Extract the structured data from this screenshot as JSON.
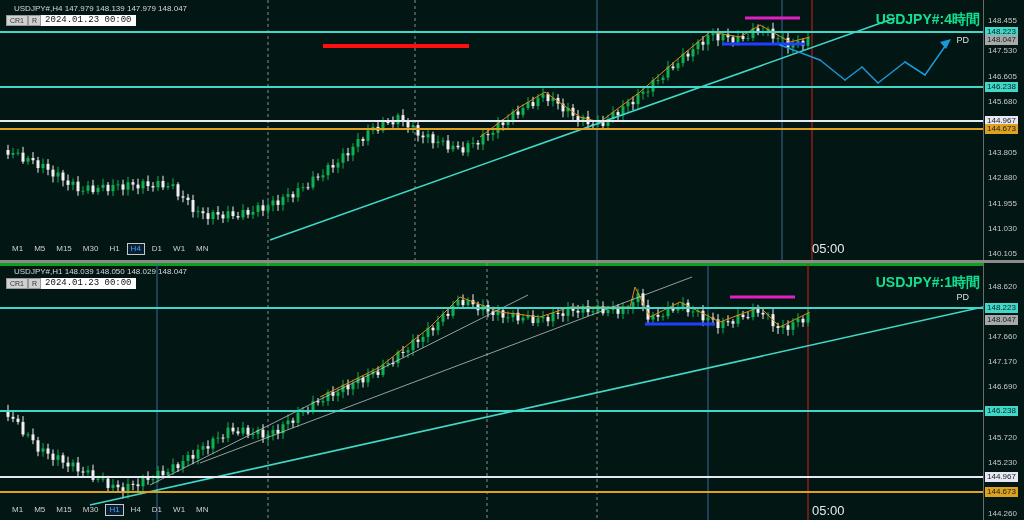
{
  "panels": [
    {
      "header": "USDJPY#,H4  147.979 148.139 147.979 148.047",
      "buttons": [
        "CR1",
        "R"
      ],
      "date": "2024.01.23 00:00",
      "title": "USDJPY#:4時間",
      "note": "PD",
      "time_label": "05:00",
      "timeframes": [
        {
          "label": "M1",
          "selected": false
        },
        {
          "label": "M5",
          "selected": false
        },
        {
          "label": "M15",
          "selected": false
        },
        {
          "label": "M30",
          "selected": false
        },
        {
          "label": "H1",
          "selected": false
        },
        {
          "label": "H4",
          "selected": true
        },
        {
          "label": "D1",
          "selected": false
        },
        {
          "label": "W1",
          "selected": false
        },
        {
          "label": "MN",
          "selected": false
        }
      ],
      "axis_ticks": [
        "148.455",
        "147.530",
        "146.605",
        "145.680",
        "143.805",
        "142.880",
        "141.955",
        "141.030",
        "140.105"
      ],
      "price_tags": [
        {
          "text": "148.223",
          "color": "#40d8c8",
          "kind": "level"
        },
        {
          "text": "148.047",
          "color": "#a8a8a8",
          "kind": "current"
        },
        {
          "text": "146.238",
          "color": "#40d8c8",
          "kind": "level"
        },
        {
          "text": "144.967",
          "color": "#e8e8f4",
          "kind": "level"
        },
        {
          "text": "144.673",
          "color": "#e0a020",
          "kind": "level"
        }
      ]
    },
    {
      "header": "USDJPY#,H1  148.039 148.050 148.029 148.047",
      "buttons": [
        "CR1",
        "R"
      ],
      "date": "2024.01.23 00:00",
      "title": "USDJPY#:1時間",
      "note": "PD",
      "time_label": "05:00",
      "timeframes": [
        {
          "label": "M1",
          "selected": false
        },
        {
          "label": "M5",
          "selected": false
        },
        {
          "label": "M15",
          "selected": false
        },
        {
          "label": "M30",
          "selected": false
        },
        {
          "label": "H1",
          "selected": true
        },
        {
          "label": "H4",
          "selected": false
        },
        {
          "label": "D1",
          "selected": false
        },
        {
          "label": "W1",
          "selected": false
        },
        {
          "label": "MN",
          "selected": false
        }
      ],
      "axis_ticks": [
        "148.620",
        "147.660",
        "147.170",
        "146.690",
        "145.720",
        "145.230",
        "144.260"
      ],
      "price_tags": [
        {
          "text": "148.223",
          "color": "#40d8c8",
          "kind": "level"
        },
        {
          "text": "148.047",
          "color": "#a8a8a8",
          "kind": "current"
        },
        {
          "text": "146.238",
          "color": "#40d8c8",
          "kind": "level"
        },
        {
          "text": "144.967",
          "color": "#e8e8f4",
          "kind": "level"
        },
        {
          "text": "144.673",
          "color": "#e0a020",
          "kind": "level"
        }
      ]
    }
  ]
}
